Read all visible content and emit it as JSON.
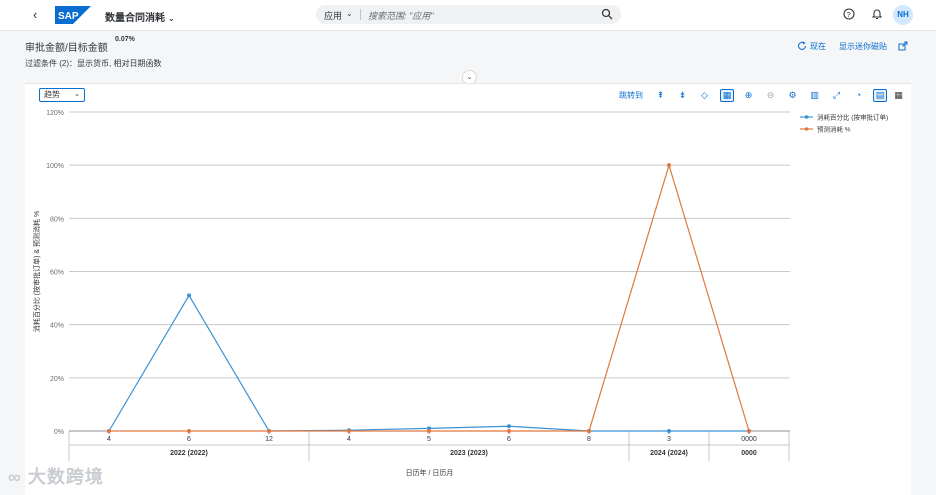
{
  "shell": {
    "app_title": "数量合同消耗",
    "search_scope": "应用",
    "search_placeholder": "搜索范围: \"应用\"",
    "avatar_initials": "NH"
  },
  "header": {
    "kpi_title": "审批金额/目标金额",
    "kpi_value": "0.07%",
    "filters": "过滤条件 (2)：显示货币, 相对日期函数",
    "now_label": "现在",
    "show_tile_label": "显示迷你磁贴"
  },
  "card": {
    "view_select": "趋势",
    "jump_label": "跳转到"
  },
  "colors": {
    "accent": "#0a6ed1",
    "series1": "#3a93d6",
    "series2": "#e0773d"
  },
  "chart_data": {
    "type": "line",
    "x": [
      "4",
      "6",
      "12",
      "4",
      "5",
      "6",
      "8",
      "3",
      "0000"
    ],
    "groups": [
      {
        "label": "2022 (2022)",
        "span": 3
      },
      {
        "label": "2023 (2023)",
        "span": 4
      },
      {
        "label": "2024 (2024)",
        "span": 1
      },
      {
        "label": "0000",
        "span": 1
      }
    ],
    "series": [
      {
        "name": "消耗百分比 (按审批订单)",
        "color": "#3a93d6",
        "values": [
          0,
          51,
          0,
          0.3,
          1,
          1.8,
          0,
          0,
          0
        ]
      },
      {
        "name": "预测消耗 %",
        "color": "#e0773d",
        "values": [
          0,
          0,
          0,
          0,
          0,
          0,
          0,
          100,
          0
        ]
      }
    ],
    "y_ticks": [
      "0%",
      "20%",
      "40%",
      "60%",
      "80%",
      "100%",
      "120%"
    ],
    "ylim": [
      0,
      120
    ],
    "ylabel": "消耗百分比 (按审批订单) & 预测消耗 %",
    "xlabel": "日历年 / 日历月",
    "grid": true,
    "legend": "top-right"
  }
}
